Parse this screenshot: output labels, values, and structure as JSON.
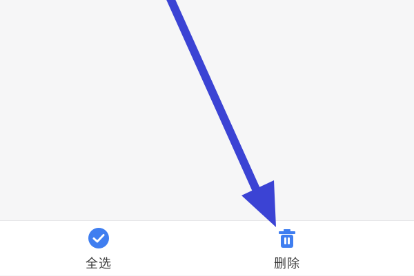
{
  "toolbar": {
    "select_all": {
      "label": "全选",
      "icon": "check-circle-icon"
    },
    "delete": {
      "label": "删除",
      "icon": "trash-icon"
    }
  },
  "colors": {
    "accent": "#3f7ef0",
    "arrow": "#3b43d4",
    "background": "#f6f6f7",
    "toolbar_background": "#ffffff",
    "label_text": "#3c3c3c"
  }
}
